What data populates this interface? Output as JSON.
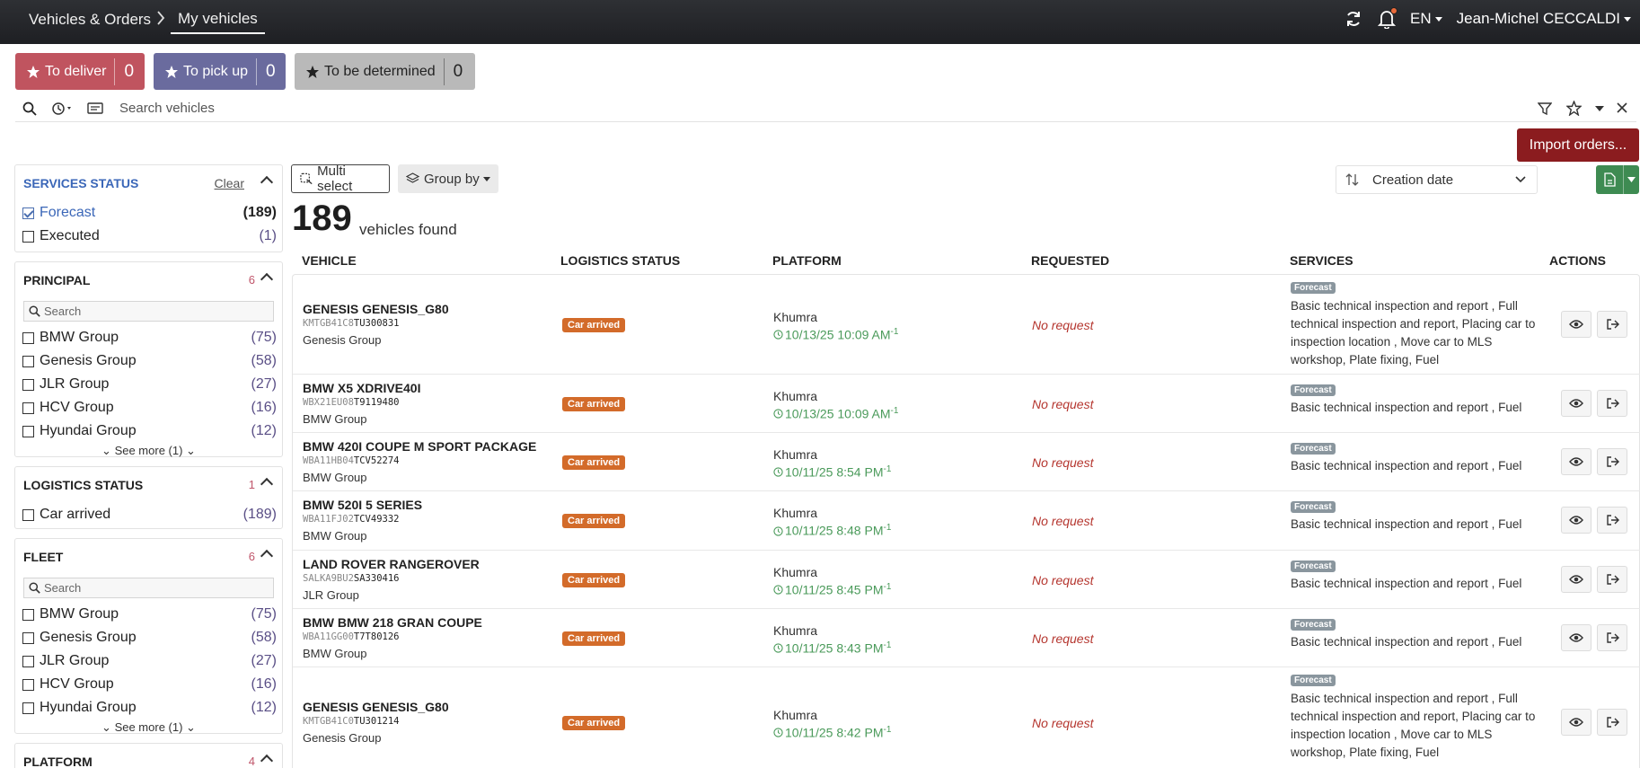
{
  "header": {
    "breadcrumb_root": "Vehicles & Orders",
    "breadcrumb_current": "My vehicles",
    "language": "EN",
    "user": "Jean-Michel CECCALDI"
  },
  "quick_filters": [
    {
      "label": "To deliver",
      "count": "0",
      "color": "#c0545f"
    },
    {
      "label": "To pick up",
      "count": "0",
      "color": "#6a6b9e"
    },
    {
      "label": "To be determined",
      "count": "0",
      "color": "#9a9a9a"
    }
  ],
  "search": {
    "placeholder": "Search vehicles"
  },
  "import_label": "Import orders...",
  "facets": {
    "services_status": {
      "title": "SERVICES STATUS",
      "clear": "Clear",
      "options": [
        {
          "label": "Forecast",
          "count": "(189)"
        },
        {
          "label": "Executed",
          "count": "(1)"
        }
      ]
    },
    "principal": {
      "title": "PRINCIPAL",
      "badge": "6",
      "search_placeholder": "Search",
      "options": [
        {
          "label": "BMW Group",
          "count": "(75)"
        },
        {
          "label": "Genesis Group",
          "count": "(58)"
        },
        {
          "label": "JLR Group",
          "count": "(27)"
        },
        {
          "label": "HCV Group",
          "count": "(16)"
        },
        {
          "label": "Hyundai Group",
          "count": "(12)"
        }
      ],
      "see_more": "See more (1)"
    },
    "logistics_status": {
      "title": "LOGISTICS STATUS",
      "badge": "1",
      "options": [
        {
          "label": "Car arrived",
          "count": "(189)"
        }
      ]
    },
    "fleet": {
      "title": "FLEET",
      "badge": "6",
      "search_placeholder": "Search",
      "options": [
        {
          "label": "BMW Group",
          "count": "(75)"
        },
        {
          "label": "Genesis Group",
          "count": "(58)"
        },
        {
          "label": "JLR Group",
          "count": "(27)"
        },
        {
          "label": "HCV Group",
          "count": "(16)"
        },
        {
          "label": "Hyundai Group",
          "count": "(12)"
        }
      ],
      "see_more": "See more (1)"
    },
    "platform": {
      "title": "PLATFORM",
      "badge": "4"
    }
  },
  "toolbar": {
    "multi_select": "Multi select",
    "group_by": "Group by",
    "sort": "Creation date"
  },
  "results": {
    "count": "189",
    "label": "vehicles found"
  },
  "columns": [
    "VEHICLE",
    "LOGISTICS STATUS",
    "PLATFORM",
    "REQUESTED",
    "SERVICES",
    "ACTIONS"
  ],
  "rows": [
    {
      "name": "GENESIS GENESIS_G80",
      "vin_prefix": "KMTGB41C8",
      "vin_suffix": "TU300831",
      "group": "Genesis Group",
      "status": "Car arrived",
      "platform": "Khumra",
      "date": "10/13/25 10:09 AM",
      "offset": "-1",
      "requested": "No request",
      "service_status": "Forecast",
      "services": "Basic technical inspection and report , Full technical inspection and report, Placing car to inspection location , Move car to MLS workshop, Plate fixing, Fuel"
    },
    {
      "name": "BMW X5 XDRIVE40I",
      "vin_prefix": "WBX21EU08",
      "vin_suffix": "T9119480",
      "group": "BMW Group",
      "status": "Car arrived",
      "platform": "Khumra",
      "date": "10/13/25 10:09 AM",
      "offset": "-1",
      "requested": "No request",
      "service_status": "Forecast",
      "services": "Basic technical inspection and report , Fuel"
    },
    {
      "name": "BMW 420I COUPE M SPORT PACKAGE",
      "vin_prefix": "WBA11HB04",
      "vin_suffix": "TCV52274",
      "group": "BMW Group",
      "status": "Car arrived",
      "platform": "Khumra",
      "date": "10/11/25 8:54 PM",
      "offset": "-1",
      "requested": "No request",
      "service_status": "Forecast",
      "services": "Basic technical inspection and report , Fuel"
    },
    {
      "name": "BMW 520I 5 SERIES",
      "vin_prefix": "WBA11FJ02",
      "vin_suffix": "TCV49332",
      "group": "BMW Group",
      "status": "Car arrived",
      "platform": "Khumra",
      "date": "10/11/25 8:48 PM",
      "offset": "-1",
      "requested": "No request",
      "service_status": "Forecast",
      "services": "Basic technical inspection and report , Fuel"
    },
    {
      "name": "LAND ROVER RANGEROVER",
      "vin_prefix": "SALKA9BU2",
      "vin_suffix": "SA330416",
      "group": "JLR Group",
      "status": "Car arrived",
      "platform": "Khumra",
      "date": "10/11/25 8:45 PM",
      "offset": "-1",
      "requested": "No request",
      "service_status": "Forecast",
      "services": "Basic technical inspection and report , Fuel"
    },
    {
      "name": "BMW BMW 218 GRAN COUPE",
      "vin_prefix": "WBA11GG00",
      "vin_suffix": "T7T80126",
      "group": "BMW Group",
      "status": "Car arrived",
      "platform": "Khumra",
      "date": "10/11/25 8:43 PM",
      "offset": "-1",
      "requested": "No request",
      "service_status": "Forecast",
      "services": "Basic technical inspection and report , Fuel"
    },
    {
      "name": "GENESIS GENESIS_G80",
      "vin_prefix": "KMTGB41C0",
      "vin_suffix": "TU301214",
      "group": "Genesis Group",
      "status": "Car arrived",
      "platform": "Khumra",
      "date": "10/11/25 8:42 PM",
      "offset": "-1",
      "requested": "No request",
      "service_status": "Forecast",
      "services": "Basic technical inspection and report , Full technical inspection and report, Placing car to inspection location , Move car to MLS workshop, Plate fixing, Fuel"
    }
  ]
}
